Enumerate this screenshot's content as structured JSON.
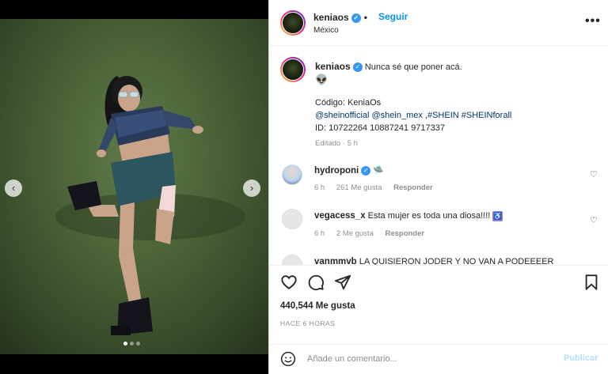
{
  "post": {
    "username": "keniaos",
    "follow_label": "Seguir",
    "location": "México",
    "more_icon": "more-horizontal-icon"
  },
  "caption": {
    "username": "keniaos",
    "text": "Nunca sé que poner acá.",
    "emoji": "👽",
    "code_line": "Código: KeniaOs",
    "tags_line": "@sheinofficial @shein_mex ,#SHEIN #SHEINforall",
    "id_line": "ID: 10722264 10887241 9717337",
    "edited": "Editado",
    "time": "5 h"
  },
  "comments": [
    {
      "username": "hydroponi",
      "verified": true,
      "text": "🛸",
      "time": "6 h",
      "likes": "261 Me gusta",
      "reply": "Responder"
    },
    {
      "username": "vegacess_x",
      "verified": false,
      "text": "Esta mujer es toda una diosa!!!!",
      "time": "6 h",
      "likes": "2 Me gusta",
      "reply": "Responder"
    },
    {
      "username": "vanmmvb",
      "text": "LA QUISIERON JODER Y NO VAN A PODEEEER"
    }
  ],
  "actions": {
    "likes": "440,544 Me gusta",
    "posted_ago": "HACE 6 HORAS"
  },
  "add_comment": {
    "placeholder": "Añade un comentario...",
    "publish_label": "Publicar"
  },
  "carousel": {
    "current": 1,
    "total": 3
  },
  "colors": {
    "link": "#0095f6",
    "verified": "#3897f0",
    "muted": "#8e8e8e",
    "publish_disabled": "#b2dffc"
  }
}
